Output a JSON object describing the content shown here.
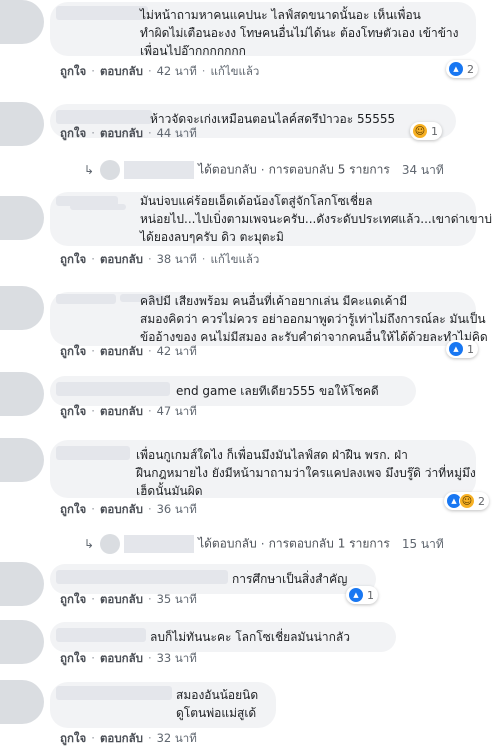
{
  "colors": {
    "like": "#1877f2",
    "haha": "#f7b125",
    "bubble": "#f2f3f5",
    "meta": "#606770"
  },
  "labels": {
    "like": "ถูกใจ",
    "reply": "ตอบกลับ",
    "edited": "แก้ไขแล้ว",
    "dot": "·"
  },
  "comments": [
    {
      "text": "ไม่หน้าถามหาคนแคปนะ ไลฟ์สดขนาดนั้นอะ เห็นเพื่อน\nทำผิดไม่เตือนอะงง โทษคนอื่นไม่ได้นะ ต้องโทษตัวเอง เข้าข้าง\nเพื่อนไปอ๊ากกกกกกก",
      "time": "42 นาที",
      "edited": true,
      "reaction_icons": [
        "like-icon"
      ],
      "reaction_count": "2"
    },
    {
      "text": "ห้าวจัดจะเก่งเหมือนตอนไลค์สดรึป่าวอะ 55555",
      "time": "44 นาที",
      "edited": false,
      "reaction_icons": [
        "haha-icon"
      ],
      "reaction_count": "1"
    },
    {
      "text": "มันบ่จบแค่ร้อยเอ็ดเด้อน้องโตสู่จักโลกโซเชี่ยล\nหน่อยไป...ไปเบิ่งตามเพจนะครับ...ดังระดับประเทศแล้ว...เขาด่าเขาบ่\nได้ยองลบๆครับ ดิว ตะมุตะมิ",
      "time": "38 นาที",
      "edited": true,
      "reaction_icons": [],
      "reaction_count": ""
    },
    {
      "text": "คลิปมี เสียงพร้อม คนอื่นที่เค้าอยากเล่น มีคะแดเค้ามี\nสมองคิดว่า ควรไม่ควร อย่าออกมาพูดว่ารู้เท่าไม่ถึงการณ์ละ มันเป็น\nข้ออ้างของ คนไม่มีสมอง ละรับคำด่าจากคนอื่นให้ได้ด้วยละทำไม่คิด",
      "time": "42 นาที",
      "edited": false,
      "reaction_icons": [
        "like-icon"
      ],
      "reaction_count": "1"
    },
    {
      "text": "end game เลยทีเดียว555 ขอให้โชคดี",
      "time": "47 นาที",
      "edited": false,
      "reaction_icons": [],
      "reaction_count": ""
    },
    {
      "text": "เพื่อนกูเกมส์ใดไง ก็เพื่อนมึงมันไลฟ์สด ฝ่าฝืน พรก. ฝ่า\nฝืนกฎหมายไง ยังมีหน้ามาถามว่าใครแคปลงเพจ มึงบรู๊ดิ ว่าที่หมู่มึง\nเฮ็ดนั้นมันผิด",
      "time": "36 นาที",
      "edited": false,
      "reaction_icons": [
        "like-icon",
        "haha-icon"
      ],
      "reaction_count": "2"
    },
    {
      "text": "การศึกษาเป็นสิ่งสำคัญ",
      "time": "35 นาที",
      "edited": false,
      "reaction_icons": [
        "like-icon"
      ],
      "reaction_count": "1"
    },
    {
      "text": "ลบก็ไม่ทันนะคะ โลกโซเชี่ยลมันน่ากลัว",
      "time": "33 นาที",
      "edited": false,
      "reaction_icons": [],
      "reaction_count": ""
    },
    {
      "text": "สมองอันน้อยนิด\nดูโตนพ่อแม่สูเด้",
      "time": "32 นาที",
      "edited": false,
      "reaction_icons": [],
      "reaction_count": ""
    }
  ],
  "reply_rows": [
    {
      "label": "ได้ตอบกลับ",
      "count": "การตอบกลับ 5 รายการ",
      "time": "34 นาที"
    },
    {
      "label": "ได้ตอบกลับ",
      "count": "การตอบกลับ 1 รายการ",
      "time": "15 นาที"
    }
  ]
}
